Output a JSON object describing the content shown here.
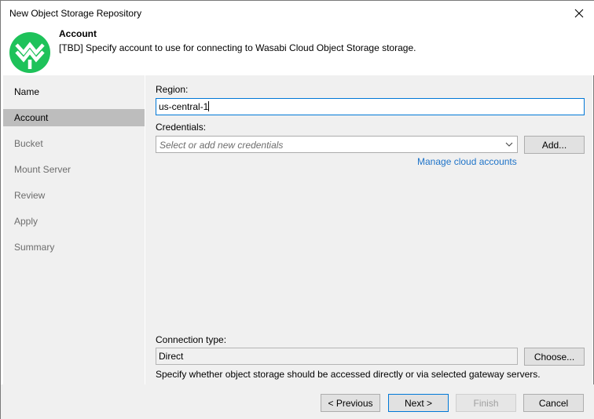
{
  "window": {
    "title": "New Object Storage Repository"
  },
  "header": {
    "title": "Account",
    "description": "[TBD] Specify account to use for connecting to Wasabi Cloud Object Storage storage."
  },
  "sidebar": {
    "items": [
      {
        "label": "Name"
      },
      {
        "label": "Account"
      },
      {
        "label": "Bucket"
      },
      {
        "label": "Mount Server"
      },
      {
        "label": "Review"
      },
      {
        "label": "Apply"
      },
      {
        "label": "Summary"
      }
    ],
    "active": "Account"
  },
  "form": {
    "region_label": "Region:",
    "region_value": "us-central-1",
    "credentials_label": "Credentials:",
    "credentials_placeholder": "Select or add new credentials",
    "add_button": "Add...",
    "manage_link": "Manage cloud accounts",
    "connection_label": "Connection type:",
    "connection_value": "Direct",
    "choose_button": "Choose...",
    "connection_description": "Specify whether object storage should be accessed directly or via selected gateway servers."
  },
  "footer": {
    "previous": "< Previous",
    "next": "Next >",
    "finish": "Finish",
    "cancel": "Cancel"
  },
  "colors": {
    "logo_green": "#1ec25a",
    "link_blue": "#1e73c8",
    "focus_blue": "#0078d7",
    "active_nav": "#bdbdbd"
  }
}
